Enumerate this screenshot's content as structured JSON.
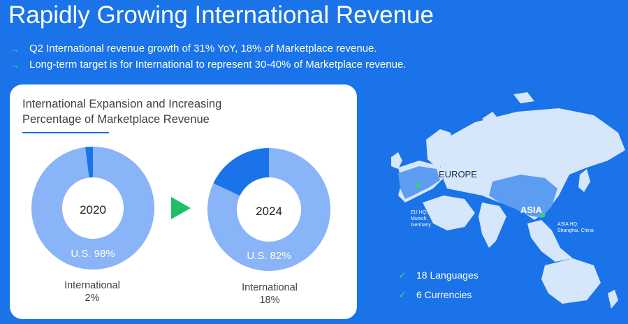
{
  "title": "Rapidly Growing International Revenue",
  "bullets": [
    "Q2 International revenue growth of 31% YoY, 18% of Marketplace revenue.",
    "Long-term target is for International to represent 30-40% of Marketplace revenue."
  ],
  "bullet_icon": "arrow-right-icon",
  "card": {
    "title_line1": "International Expansion and Increasing",
    "title_line2": "Percentage of Marketplace Revenue"
  },
  "colors": {
    "background": "#1a73e8",
    "us_slice": "#8ab4f8",
    "international_slice": "#1a73e8",
    "accent_green": "#1fbf6a"
  },
  "chart_data": [
    {
      "type": "pie",
      "center_label": "2020",
      "categories": [
        "U.S.",
        "International"
      ],
      "values": [
        98,
        2
      ],
      "data_labels": [
        "U.S. 98%",
        "International\n2%"
      ]
    },
    {
      "type": "pie",
      "center_label": "2024",
      "categories": [
        "U.S.",
        "International"
      ],
      "values": [
        82,
        18
      ],
      "data_labels": [
        "U.S. 82%",
        "International\n18%"
      ]
    }
  ],
  "donut_labels": {
    "d2020": {
      "us": "U.S. 98%",
      "intl_line1": "International",
      "intl_line2": "2%"
    },
    "d2024": {
      "us": "U.S. 82%",
      "intl_line1": "International",
      "intl_line2": "18%"
    }
  },
  "map": {
    "europe_label": "EUROPE",
    "asia_label": "ASIA",
    "eu_hq_line1": "EU HQ:",
    "eu_hq_line2": "Munich,",
    "eu_hq_line3": "Germany",
    "asia_hq_line1": "ASIA HQ:",
    "asia_hq_line2": "Shanghai, China"
  },
  "features": [
    {
      "icon": "check-icon",
      "label": "18 Languages"
    },
    {
      "icon": "check-icon",
      "label": "6 Currencies"
    }
  ]
}
